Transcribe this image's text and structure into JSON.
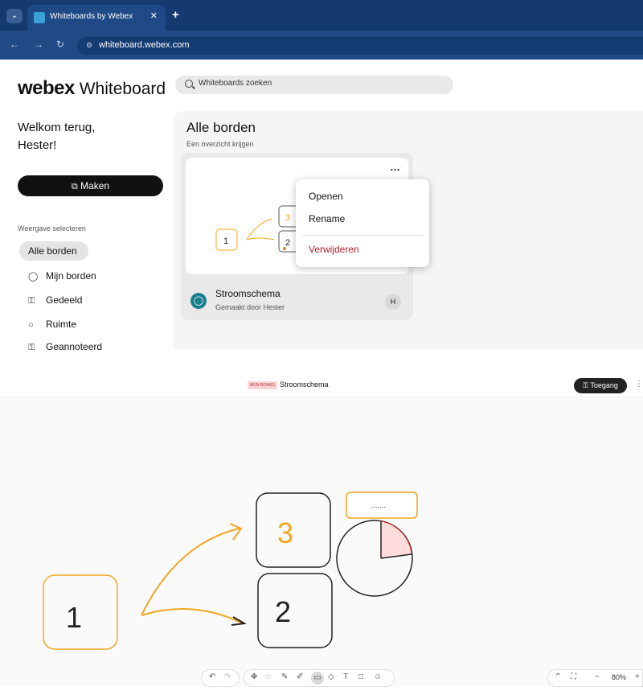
{
  "browser": {
    "tab_title": "Whiteboards by Webex",
    "url": "whiteboard.webex.com"
  },
  "app": {
    "logo_brand": "webex",
    "logo_product": "Whiteboard",
    "search_placeholder": "Whiteboards zoeken"
  },
  "sidebar": {
    "welcome": "Welkom terug, Hester!",
    "create_label": "Maken",
    "view_label": "Weergave selecteren",
    "items": [
      {
        "label": "Alle borden",
        "icon": "grid-icon"
      },
      {
        "label": "Mijn borden",
        "icon": "user-icon"
      },
      {
        "label": "Gedeeld",
        "icon": "people-icon"
      },
      {
        "label": "Ruimte",
        "icon": "chat-icon"
      },
      {
        "label": "Geannoteerd",
        "icon": "people-icon"
      }
    ]
  },
  "main": {
    "title": "Alle borden",
    "subtitle": "Een overzicht krijgen",
    "card": {
      "name": "Stroomschema",
      "author": "Gemaakt door Hester",
      "owner_initial": "H",
      "more": "…"
    },
    "menu": {
      "open": "Openen",
      "rename": "Rename",
      "delete": "Verwijderen"
    }
  },
  "editor": {
    "badge": "MIJN BOARD",
    "board_name": "Stroomschema",
    "access_label": "Toegang",
    "zoom": "80%",
    "sticky_text": ".......",
    "shape_labels": [
      "1",
      "3",
      "2"
    ]
  },
  "colors": {
    "orange": "#f2a61e",
    "danger": "#b0202a",
    "teal": "#1a7f8e",
    "chrome_dark": "#143a70"
  }
}
